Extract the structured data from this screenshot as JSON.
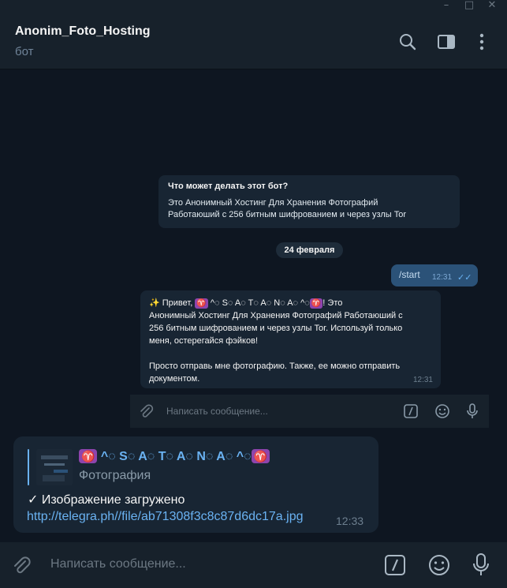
{
  "window": {
    "minimize": "–",
    "maximize": "□",
    "close": "✕"
  },
  "header": {
    "title": "Anonim_Foto_Hosting",
    "subtitle": "бот"
  },
  "embedded_chat": {
    "info_title": "Что может делать этот бот?",
    "info_text_line1": "Это Анонимный Хостинг Для Хранения Фотографий",
    "info_text_line2": "Работаюший с 256 битным шифрованием и через узлы Tor",
    "date": "24 февраля",
    "outgoing_text": "/start",
    "outgoing_time": "12:31",
    "incoming_line1_pre": "✨ Привет, ",
    "incoming_sym": "♈",
    "incoming_name": " ^◌ S◌ A◌ T◌ A◌ N◌ A◌ ^◌",
    "incoming_line1_post": "! Это",
    "incoming_line2": "Анонимный Хостинг Для Хранения Фотографий Работаюший с",
    "incoming_line3": "256 битным шифрованием и через узлы Tor. Используй только",
    "incoming_line4": "меня, остерегайся фэйков!",
    "incoming_para2_line1": "Просто отправь мне фотографию. Также, ее можно отправить",
    "incoming_para2_line2": "документом.",
    "incoming_time": "12:31",
    "input_placeholder": "Написать сообщение..."
  },
  "message": {
    "reply_sym": "♈",
    "reply_name": " ^◌ S◌ A◌ T◌ A◌ N◌ A◌ ^◌",
    "reply_sub": "Фотография",
    "status": "✓ Изображение загружено",
    "link": "http://telegra.ph//file/ab71308f3c8c87d6dc17a.jpg",
    "time": "12:33"
  },
  "composer": {
    "placeholder": "Написать сообщение..."
  },
  "colors": {
    "bg": "#0e1621",
    "panel": "#17212b",
    "bubble_in": "#182533",
    "bubble_out": "#2b5278",
    "accent": "#6ab2f2"
  }
}
